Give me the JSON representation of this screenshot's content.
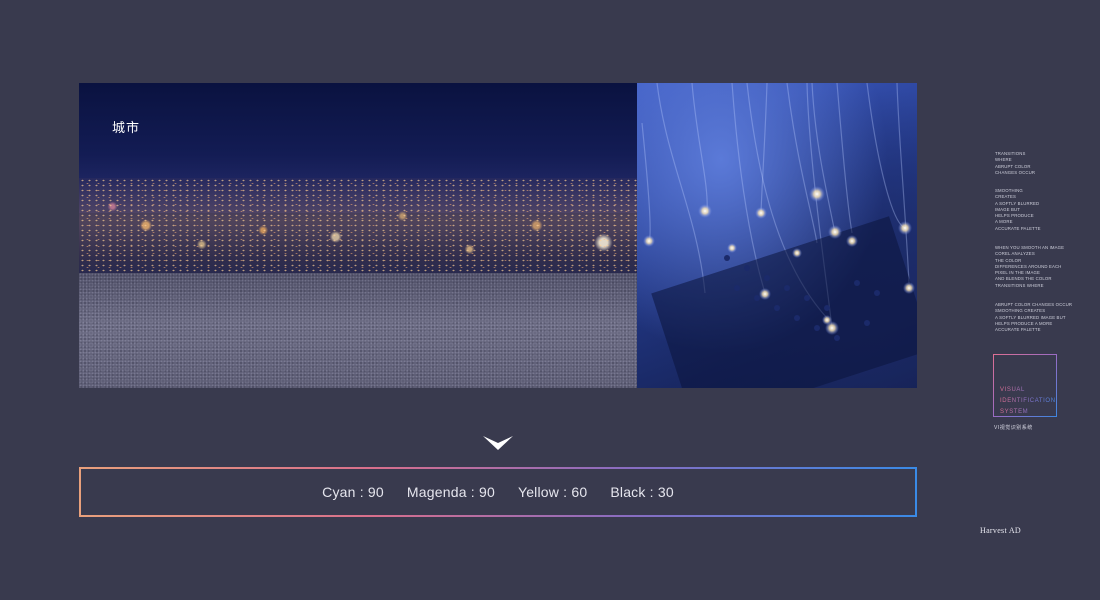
{
  "city_panel": {
    "caption": "城市"
  },
  "cmyk": {
    "cyan": "Cyan : 90",
    "magenta": "Magenda : 90",
    "yellow": "Yellow : 60",
    "black": "Black : 30"
  },
  "side_text": {
    "block1": "TRANSITIONS\nWHERE\nABRUPT COLOR\nCHANGES OCCUR",
    "block2": "SMOOTHING\nCREATES\nA SOFTLY BLURRED\nIMAGE BUT\nHELPS PRODUCE\nA MORE\nACCURATE PALETTE",
    "block3": "WHEN YOU SMOOTH AN IMAGE\nCOREL ANALYZES\nTHE COLOR\nDIFFERENCES AROUND EACH\nPIXEL IN THE IMAGE\nAND BLENDS THE COLOR\nTRANSITIONS WHERE",
    "block4": "ABRUPT COLOR CHANGES OCCUR\nSMOOTHING CREATES\nA SOFTLY BLURRED IMAGE BUT\nHELPS PRODUCE A MORE\nACCURATE PALETTE"
  },
  "vis_box": {
    "title": "VISUAL\nIDENTIFICATION\nSYSTEM",
    "subtitle": "VI视觉识别系统"
  },
  "brand": "Harvest AD",
  "colors": {
    "background": "#393a4e",
    "gradient_start": "#e9a07c",
    "gradient_mid": "#d86f8c",
    "gradient_end": "#3a8ae6"
  }
}
